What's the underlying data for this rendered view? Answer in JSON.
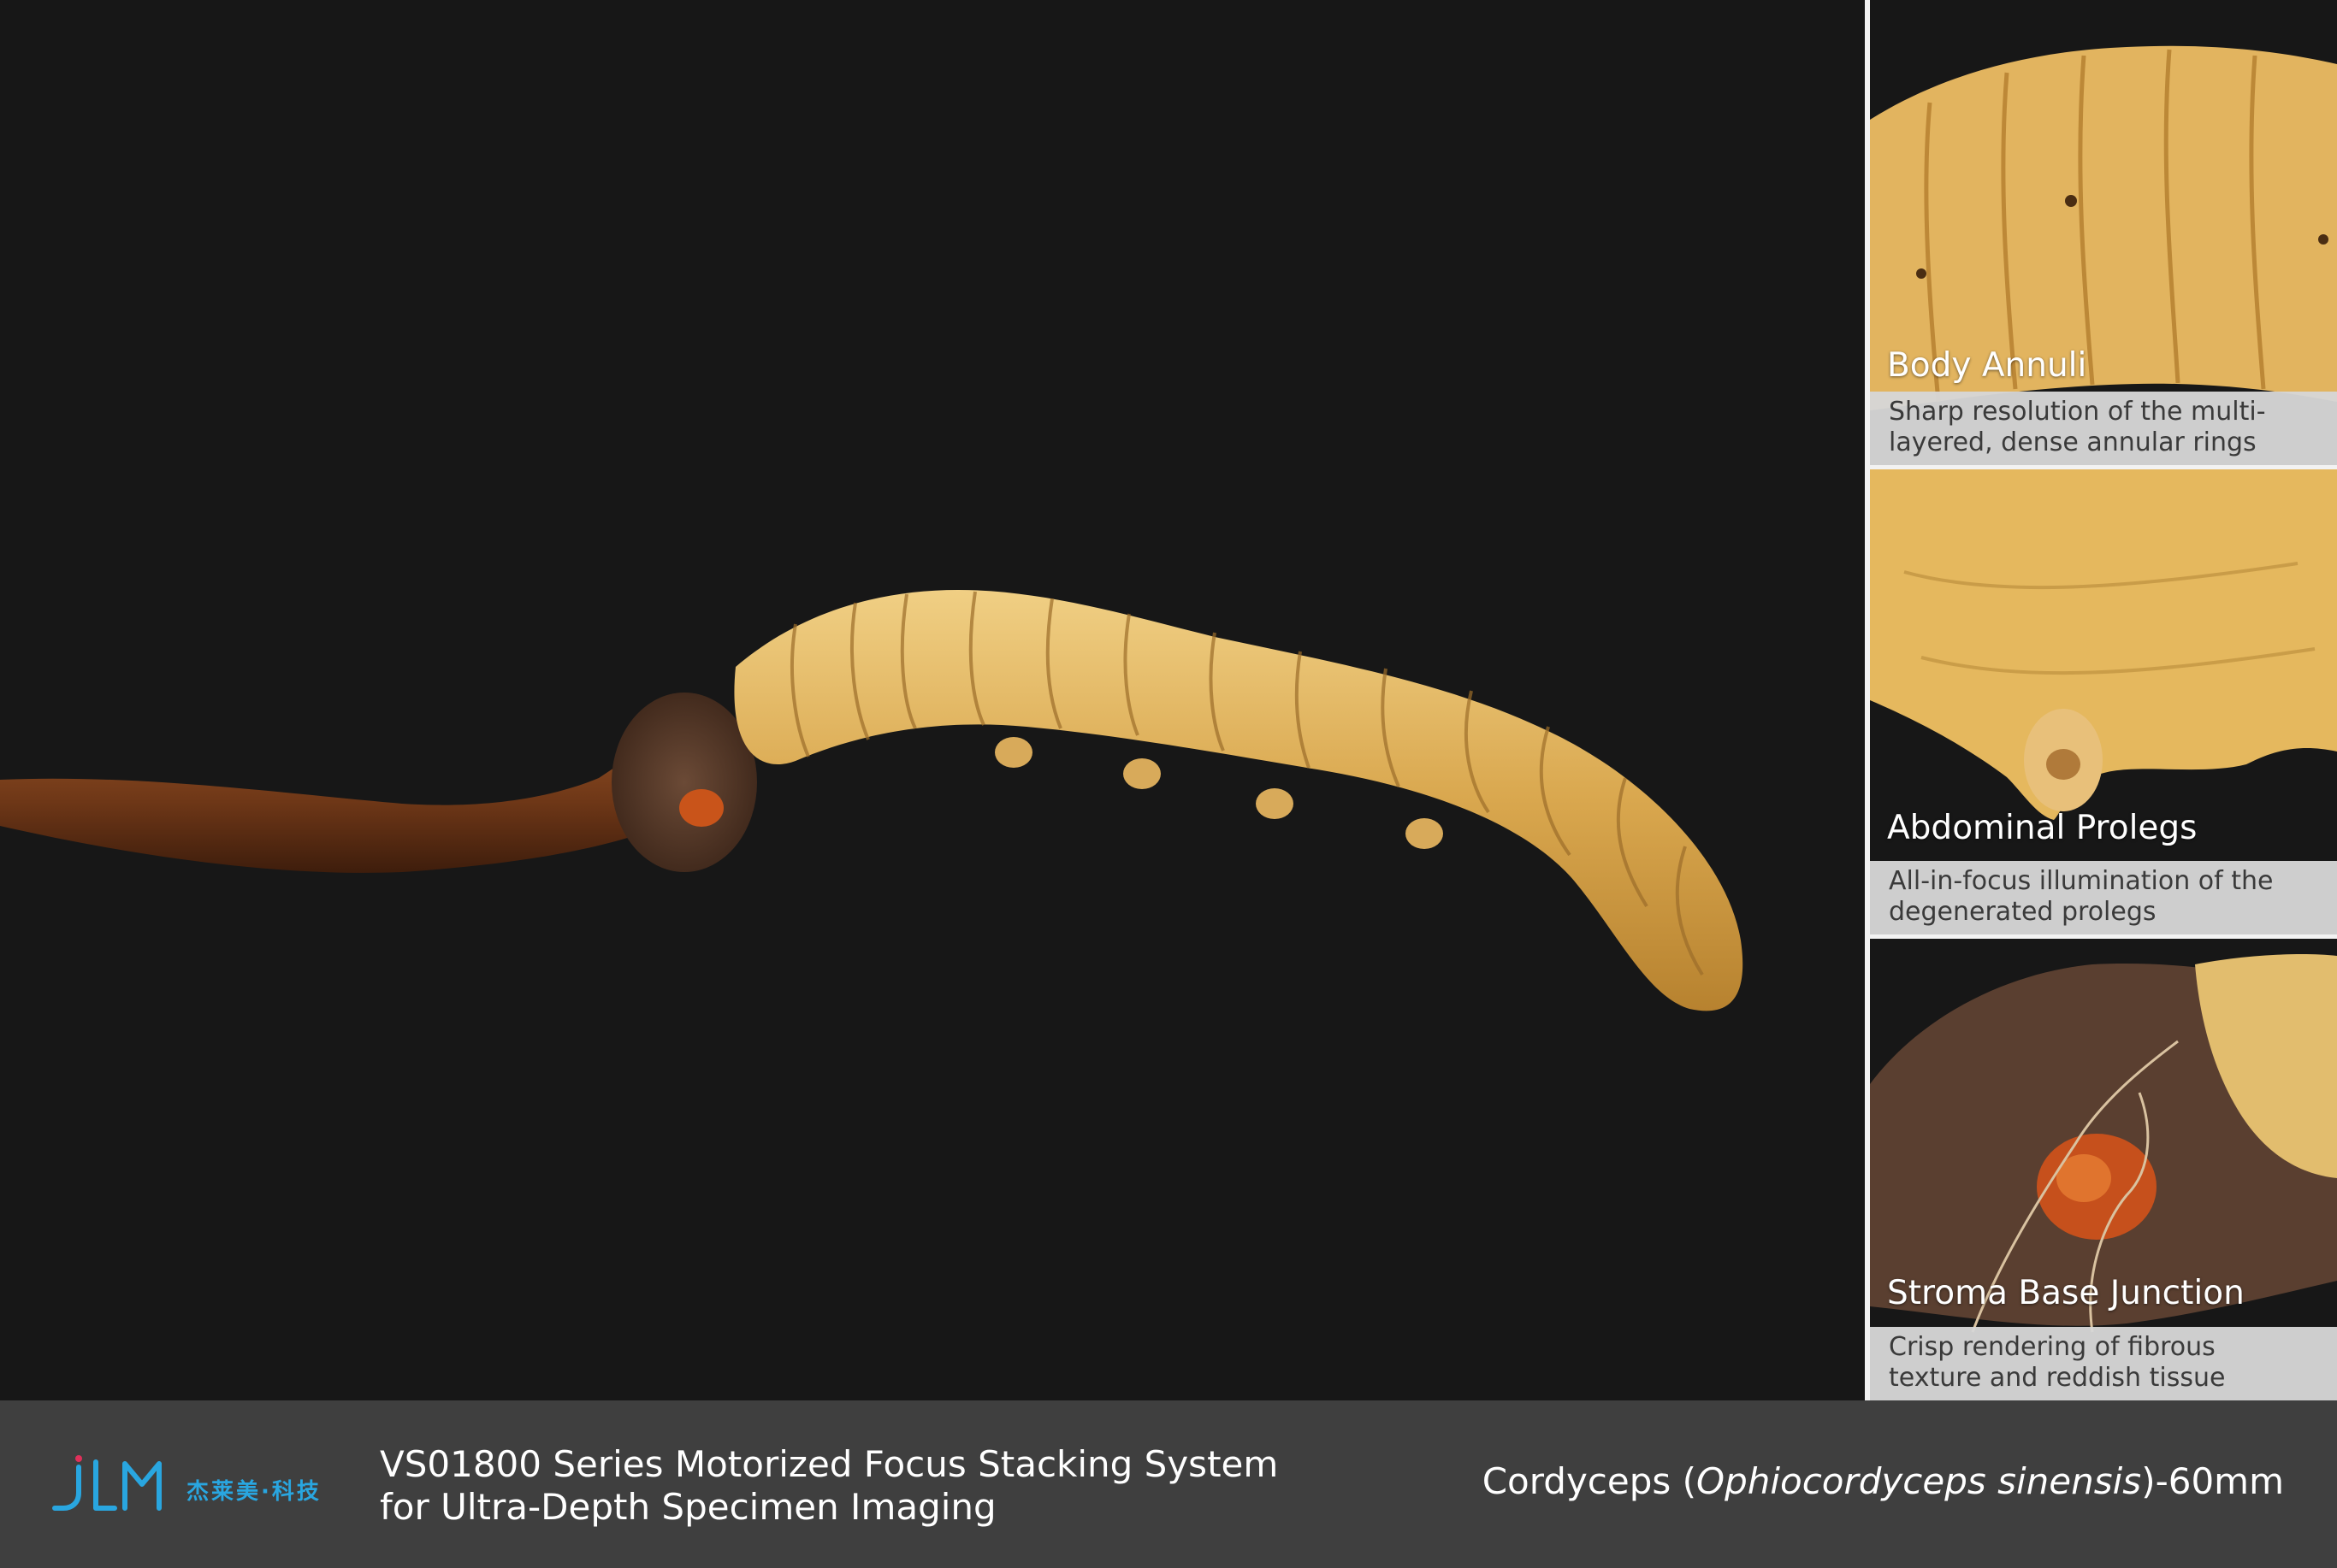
{
  "main_image": {
    "subject": "cordyceps-specimen",
    "background_color": "#171717"
  },
  "details": [
    {
      "title": "Body Annuli",
      "caption_line1": "Sharp resolution of the multi-",
      "caption_line2": "layered, dense annular rings"
    },
    {
      "title": "Abdominal Prolegs",
      "caption_line1": "All-in-focus illumination of the",
      "caption_line2": "degenerated prolegs"
    },
    {
      "title": "Stroma Base Junction",
      "caption_line1": "Crisp rendering of fibrous",
      "caption_line2": "texture and reddish tissue"
    }
  ],
  "footer": {
    "logo_text": "杰莱美·科技",
    "system_title_line1": "VS01800 Series Motorized Focus Stacking System",
    "system_title_line2": "for Ultra-Depth Specimen Imaging",
    "specimen_common": "Cordyceps (",
    "specimen_scientific": "Ophiocordyceps sinensis",
    "specimen_size": ")-60mm"
  },
  "colors": {
    "accent": "#29a6e0",
    "footer_bg": "#3f3f3f",
    "caption_bg": "#d6d6d6"
  }
}
